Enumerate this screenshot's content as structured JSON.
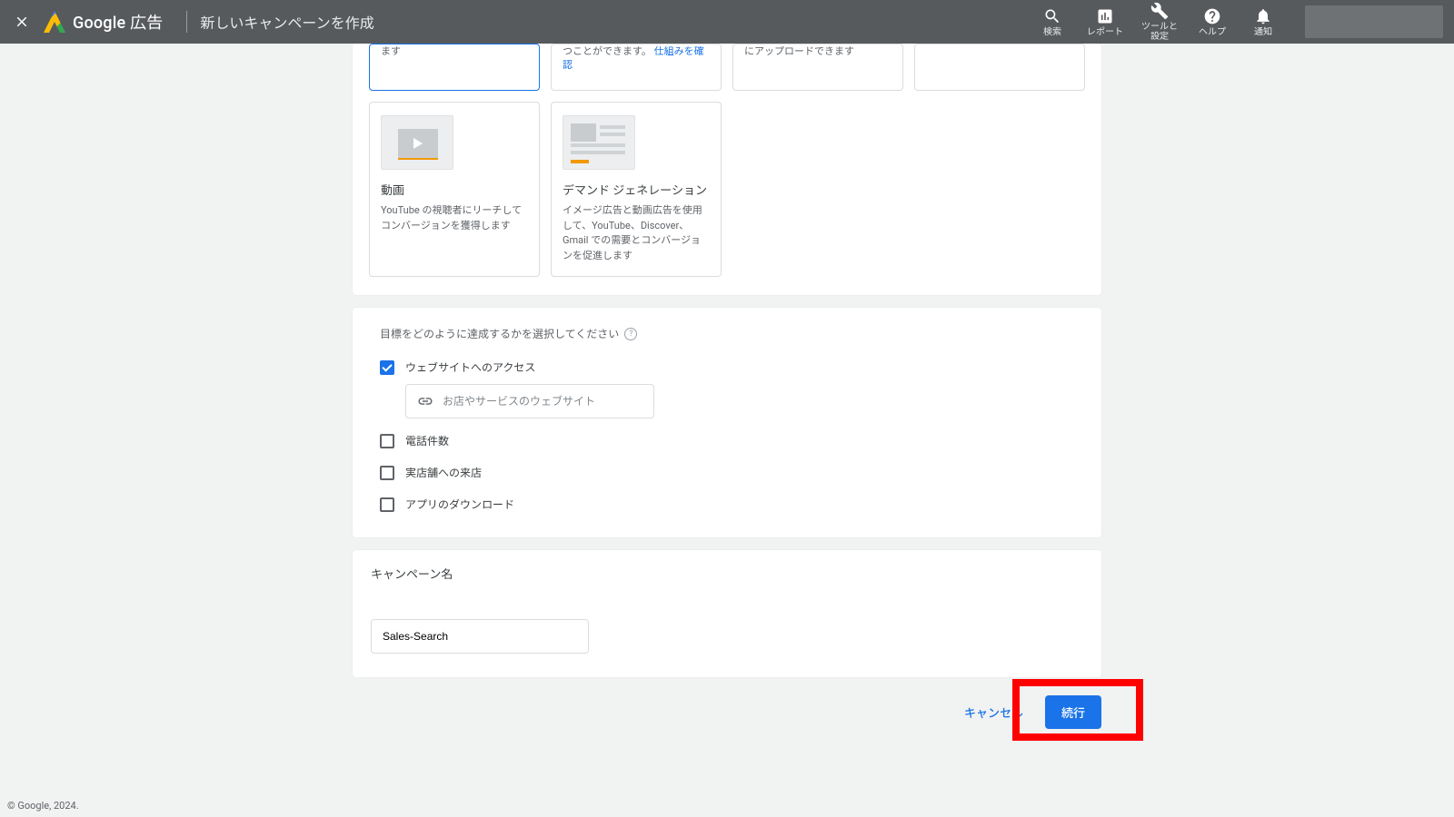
{
  "header": {
    "product_prefix": "Google",
    "product_suffix": " 広告",
    "page_title": "新しいキャンペーンを作成",
    "actions": {
      "search": "検索",
      "reports": "レポート",
      "tools": "ツールと\n設定",
      "help": "ヘルプ",
      "notifications": "通知"
    }
  },
  "campaign_types": {
    "row1": [
      {
        "partial_desc": "ます",
        "selected": true
      },
      {
        "partial_desc": "つことができます。 ",
        "link": "仕組みを確認"
      },
      {
        "partial_desc": "にアップロードできます"
      },
      {
        "partial_desc": ""
      }
    ],
    "video": {
      "title": "動画",
      "desc": "YouTube の視聴者にリーチしてコンバージョンを獲得します"
    },
    "demand": {
      "title": "デマンド ジェネレーション",
      "desc": "イメージ広告と動画広告を使用して、YouTube、Discover、Gmail での需要とコンバージョンを促進します"
    }
  },
  "goal": {
    "heading": "目標をどのように達成するかを選択してください",
    "options": {
      "website": "ウェブサイトへのアクセス",
      "phone": "電話件数",
      "store": "実店舗への来店",
      "app": "アプリのダウンロード"
    },
    "url_placeholder": "お店やサービスのウェブサイト"
  },
  "campaign_name": {
    "heading": "キャンペーン名",
    "value": "Sales-Search"
  },
  "buttons": {
    "cancel": "キャンセル",
    "continue": "続行"
  },
  "footer": "© Google, 2024."
}
